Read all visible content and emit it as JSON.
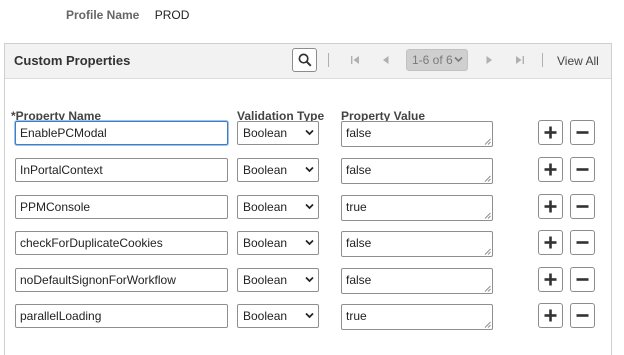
{
  "profile": {
    "label": "Profile Name",
    "value": "PROD"
  },
  "panel": {
    "title": "Custom Properties",
    "pagination": {
      "range": "1-6 of 6",
      "view_all": "View All"
    }
  },
  "columns": {
    "required_mark": "*",
    "property_name": "Property Name",
    "validation_type": "Validation Type",
    "property_value": "Property Value"
  },
  "rows": [
    {
      "name": "EnablePCModal",
      "type": "Boolean",
      "value": "false"
    },
    {
      "name": "InPortalContext",
      "type": "Boolean",
      "value": "false"
    },
    {
      "name": "PPMConsole",
      "type": "Boolean",
      "value": "true"
    },
    {
      "name": "checkForDuplicateCookies",
      "type": "Boolean",
      "value": "false"
    },
    {
      "name": "noDefaultSignonForWorkflow",
      "type": "Boolean",
      "value": "false"
    },
    {
      "name": "parallelLoading",
      "type": "Boolean",
      "value": "true"
    }
  ],
  "icons": {
    "search": "search-icon",
    "first": "first-page-icon",
    "prev": "previous-page-icon",
    "next": "next-page-icon",
    "last": "last-page-icon",
    "add": "plus-icon",
    "remove": "minus-icon"
  },
  "colors": {
    "header_bg": "#f2f2f2",
    "focus_border": "#3d7fc4",
    "disabled_nav": "#b0b0b0"
  }
}
